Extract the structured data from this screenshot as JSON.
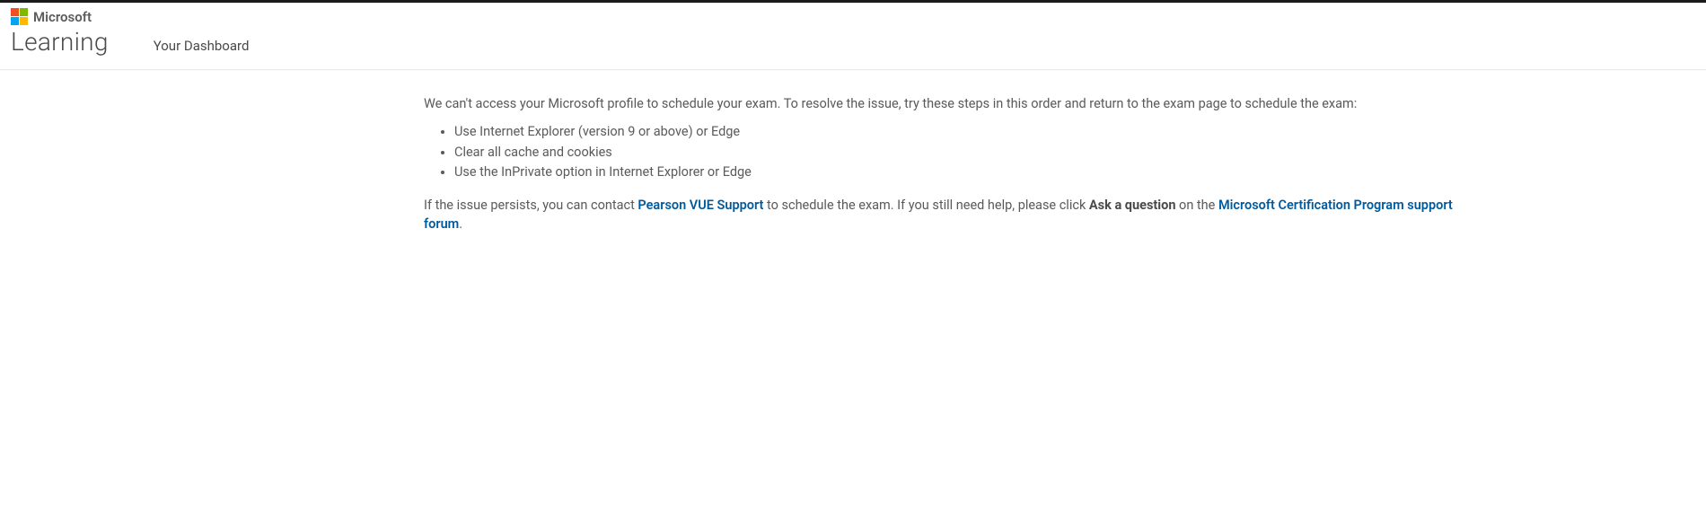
{
  "header": {
    "brand_text": "Microsoft",
    "learning_title": "Learning",
    "dashboard_label": "Your Dashboard"
  },
  "message": {
    "intro": "We can't access your Microsoft profile to schedule your exam. To resolve the issue, try these steps in this order and return to the exam page to schedule the exam:",
    "steps": [
      "Use Internet Explorer (version 9 or above) or Edge",
      "Clear all cache and cookies",
      "Use the InPrivate option in Internet Explorer or Edge"
    ],
    "followup_prefix": "If the issue persists, you can contact ",
    "link_pearson": "Pearson VUE Support",
    "followup_mid": " to schedule the exam. If you still need help, please click ",
    "bold_ask": "Ask a question",
    "followup_on": " on the ",
    "link_forum": "Microsoft Certification Program support forum",
    "followup_end": "."
  }
}
